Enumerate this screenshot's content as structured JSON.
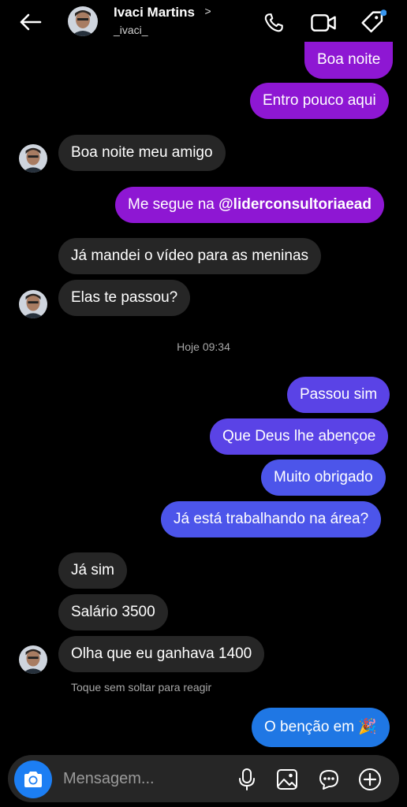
{
  "header": {
    "name": "Ivaci Martins",
    "chevron": ">",
    "handle": "_ivaci_",
    "icons": [
      "back-arrow-icon",
      "phone-icon",
      "video-call-icon",
      "tag-icon"
    ],
    "accent": "#1c7ef3"
  },
  "messages": [
    {
      "text": "Boa noite",
      "direction": "outgoing",
      "color": "#8e17d3"
    },
    {
      "text": "Entro pouco aqui",
      "direction": "outgoing",
      "color": "#8e17d3"
    },
    {
      "text": "Boa noite meu amigo",
      "direction": "incoming"
    },
    {
      "text_prefix": "Me segue na ",
      "mention": "@liderconsultoriaead",
      "direction": "outgoing",
      "color": "#8e17d3"
    },
    {
      "text": "Já mandei o vídeo para as meninas",
      "direction": "incoming"
    },
    {
      "text": "Elas te passou?",
      "direction": "incoming"
    },
    {
      "text": "Passou sim",
      "direction": "outgoing",
      "color": "#5a43e6"
    },
    {
      "text": "Que Deus lhe abençoe",
      "direction": "outgoing",
      "color": "#5a43e6"
    },
    {
      "text": "Muito obrigado",
      "direction": "outgoing",
      "color": "#4c55ea"
    },
    {
      "text": "Já está trabalhando na área?",
      "direction": "outgoing",
      "color": "#4c55ea"
    },
    {
      "text": "Já sim",
      "direction": "incoming"
    },
    {
      "text": "Salário 3500",
      "direction": "incoming"
    },
    {
      "text": "Olha que eu ganhava 1400",
      "direction": "incoming"
    },
    {
      "text": "O benção em 🎉",
      "direction": "outgoing",
      "color": "#1f77e4"
    }
  ],
  "timestamp": "Hoje 09:34",
  "hint": "Toque sem soltar para reagir",
  "composer": {
    "placeholder": "Mensagem...",
    "icons": [
      "camera-icon",
      "microphone-icon",
      "gallery-icon",
      "sticker-icon",
      "plus-icon"
    ]
  }
}
